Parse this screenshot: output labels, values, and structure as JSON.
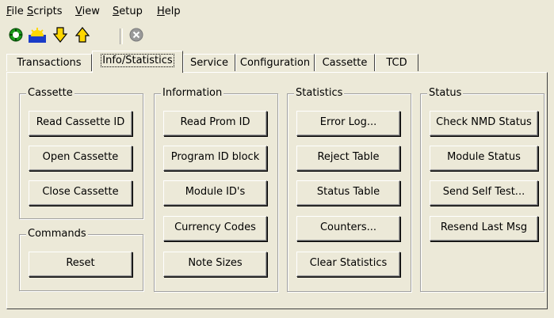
{
  "menu": [
    "File",
    "Scripts",
    "View",
    "Setup",
    "Help"
  ],
  "menu_mnemonics": [
    "F",
    "S",
    "V",
    "S",
    "H"
  ],
  "toolbar": {
    "icons": [
      "connect-icon",
      "sunrise-icon",
      "download-arrow-icon",
      "upload-arrow-icon",
      "stop-icon"
    ],
    "colors": {
      "green": "#1a9b1a",
      "yellow": "#ffd700",
      "blue": "#1a3cc8",
      "gray": "#9a9a9a"
    }
  },
  "tabs": [
    "Transactions",
    "Info/Statistics",
    "Service",
    "Configuration",
    "Cassette",
    "TCD"
  ],
  "active_tab": "Info/Statistics",
  "groups": {
    "cassette": {
      "title": "Cassette",
      "buttons": [
        "Read Cassette ID",
        "Open Cassette",
        "Close Cassette"
      ]
    },
    "commands": {
      "title": "Commands",
      "buttons": [
        "Reset"
      ]
    },
    "information": {
      "title": "Information",
      "buttons": [
        "Read Prom ID",
        "Program ID block",
        "Module ID's",
        "Currency Codes",
        "Note Sizes"
      ]
    },
    "statistics": {
      "title": "Statistics",
      "buttons": [
        "Error Log...",
        "Reject Table",
        "Status Table",
        "Counters...",
        "Clear Statistics"
      ]
    },
    "status": {
      "title": "Status",
      "buttons": [
        "Check NMD Status",
        "Module Status",
        "Send Self Test...",
        "Resend Last Msg"
      ]
    }
  }
}
